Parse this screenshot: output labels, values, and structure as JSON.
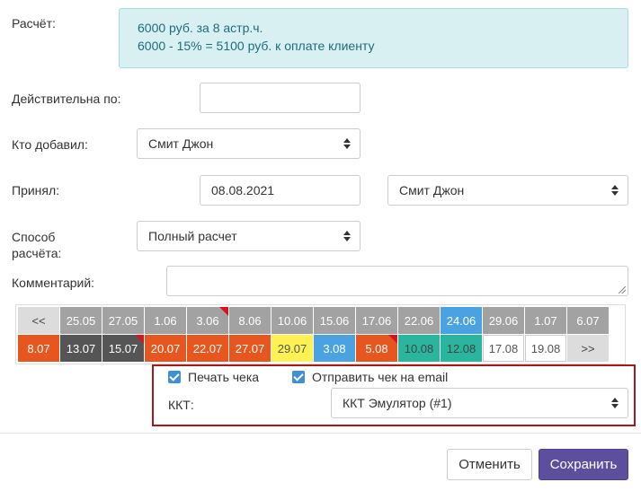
{
  "payment": {
    "label": "Расчёт:",
    "line1": "6000 руб. за 8 астр.ч.",
    "line2": "6000 - 15% = 5100 руб. к оплате клиенту"
  },
  "valid_until": {
    "label": "Действительна по:",
    "value": ""
  },
  "added_by": {
    "label": "Кто добавил:",
    "value": "Смит Джон"
  },
  "accepted": {
    "label": "Принял:",
    "date": "08.08.2021",
    "person": "Смит Джон"
  },
  "payment_method": {
    "label_line1": "Способ",
    "label_line2": "расчёта:",
    "value": "Полный расчет"
  },
  "comment": {
    "label": "Комментарий:",
    "value": ""
  },
  "calendar": {
    "row1": [
      {
        "text": "<<",
        "style": "nav"
      },
      {
        "text": "25.05",
        "style": "gray"
      },
      {
        "text": "27.05",
        "style": "gray"
      },
      {
        "text": "1.06",
        "style": "gray"
      },
      {
        "text": "3.06",
        "style": "gray",
        "flag": true
      },
      {
        "text": "8.06",
        "style": "gray"
      },
      {
        "text": "10.06",
        "style": "gray"
      },
      {
        "text": "15.06",
        "style": "gray"
      },
      {
        "text": "17.06",
        "style": "gray"
      },
      {
        "text": "22.06",
        "style": "gray"
      },
      {
        "text": "24.06",
        "style": "blue"
      },
      {
        "text": "29.06",
        "style": "gray"
      },
      {
        "text": "1.07",
        "style": "gray"
      },
      {
        "text": "6.07",
        "style": "gray"
      }
    ],
    "row2": [
      {
        "text": "8.07",
        "style": "orange"
      },
      {
        "text": "13.07",
        "style": "dgray"
      },
      {
        "text": "15.07",
        "style": "dgray",
        "flag": true
      },
      {
        "text": "20.07",
        "style": "orange"
      },
      {
        "text": "22.07",
        "style": "orange"
      },
      {
        "text": "27.07",
        "style": "orange"
      },
      {
        "text": "29.07",
        "style": "yellow"
      },
      {
        "text": "3.08",
        "style": "blue"
      },
      {
        "text": "5.08",
        "style": "orange",
        "flag": true
      },
      {
        "text": "10.08",
        "style": "teal"
      },
      {
        "text": "12.08",
        "style": "teal"
      },
      {
        "text": "17.08",
        "style": "white"
      },
      {
        "text": "19.08",
        "style": "white"
      },
      {
        "text": ">>",
        "style": "nav"
      }
    ]
  },
  "receipt": {
    "print_label": "Печать чека",
    "print_checked": true,
    "email_label": "Отправить чек на email",
    "email_checked": true,
    "kkt_label": "ККТ:",
    "kkt_value": "ККТ Эмулятор (#1)"
  },
  "footer": {
    "cancel_label": "Отменить",
    "save_label": "Сохранить"
  },
  "colors": {
    "primary": "#5d4e9e",
    "info_bg": "#d9f0f3",
    "highlight_border": "#a8171a",
    "flag": "#d9121d"
  }
}
